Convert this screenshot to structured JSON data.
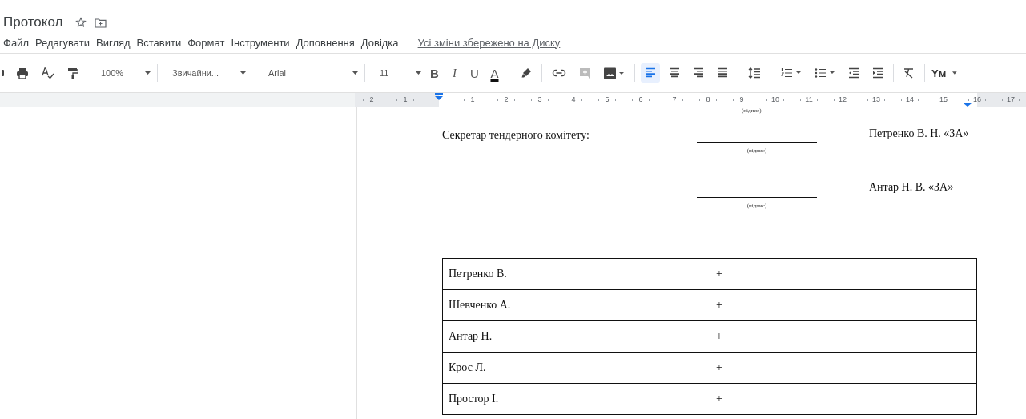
{
  "document": {
    "title": "Протокол"
  },
  "menu": [
    {
      "label": "Файл"
    },
    {
      "label": "Редагувати"
    },
    {
      "label": "Вигляд"
    },
    {
      "label": "Вставити"
    },
    {
      "label": "Формат"
    },
    {
      "label": "Інструменти"
    },
    {
      "label": "Доповнення"
    },
    {
      "label": "Довідка"
    }
  ],
  "save_status": "Усі зміни збережено на Диску",
  "toolbar": {
    "zoom": "100%",
    "style": "Звичайни...",
    "font": "Arial",
    "size": "11",
    "bold": "B",
    "italic": "I",
    "underline": "U",
    "text_color": "A",
    "alignment": [
      {
        "kind": "left",
        "selected": true
      },
      {
        "kind": "center",
        "selected": false
      },
      {
        "kind": "right",
        "selected": false
      },
      {
        "kind": "justify",
        "selected": false
      }
    ],
    "input_tools": "Yм"
  },
  "ruler": {
    "left_labels": [
      "2",
      "1"
    ],
    "right_labels": [
      "1",
      "2",
      "3",
      "4",
      "5",
      "6",
      "7",
      "8",
      "9",
      "10",
      "11",
      "12",
      "13",
      "14",
      "15",
      "16",
      "17"
    ]
  },
  "page": {
    "top_caption": "(підпис)",
    "signatures": [
      {
        "role": "Секретар тендерного комітету:",
        "caption": "(підпис)",
        "name": "Петренко В. Н. «ЗА»"
      },
      {
        "caption": "(підпис)",
        "name": "Антар Н. В. «ЗА»"
      }
    ],
    "table": [
      {
        "name": "Петренко В.",
        "vote": "+"
      },
      {
        "name": "Шевченко А.",
        "vote": "+"
      },
      {
        "name": "Антар Н.",
        "vote": "+"
      },
      {
        "name": "Крос Л.",
        "vote": "+"
      },
      {
        "name": "Простор І.",
        "vote": "+"
      }
    ]
  }
}
